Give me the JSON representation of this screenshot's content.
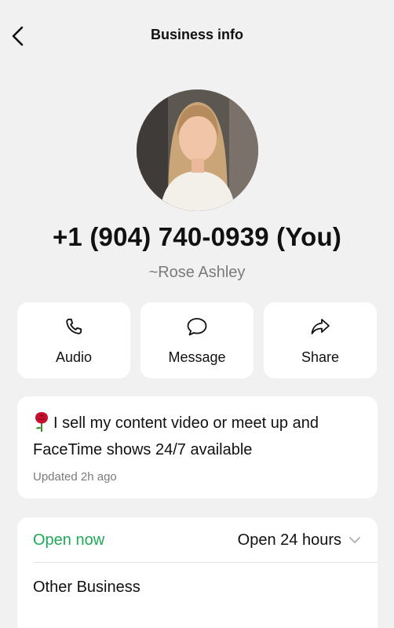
{
  "header": {
    "title": "Business info",
    "back_icon": "chevron-left-icon"
  },
  "profile": {
    "phone": "+1 (904) 740-0939 (You)",
    "display_name": "~Rose Ashley"
  },
  "actions": [
    {
      "label": "Audio",
      "icon": "phone-icon"
    },
    {
      "label": "Message",
      "icon": "chat-bubble-icon"
    },
    {
      "label": "Share",
      "icon": "share-arrow-icon"
    }
  ],
  "about": {
    "emoji_icon": "rose-emoji-icon",
    "text": "I sell my content video or meet up and FaceTime shows 24/7 available",
    "updated": "Updated 2h ago"
  },
  "hours": {
    "status": "Open now",
    "status_color": "#1fa855",
    "schedule": "Open 24 hours",
    "category": "Other Business"
  }
}
